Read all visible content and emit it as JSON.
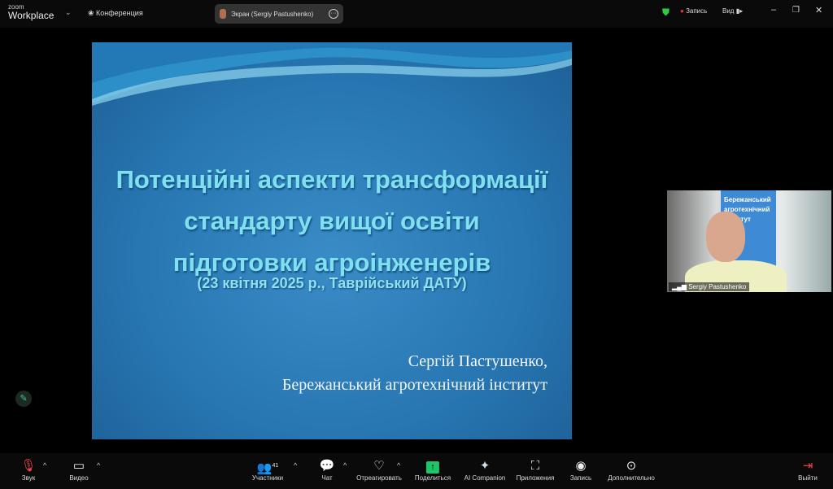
{
  "topbar": {
    "logo_small": "zoom",
    "logo_big": "Workplace",
    "meeting_label": "Конференция",
    "screen_label": "Экран (Sergiy Pastushenko)",
    "record": "Запись",
    "view": "Вид",
    "colors": {
      "shield": "#2ecc40",
      "record_dot": "#e33"
    }
  },
  "slide": {
    "title": [
      "Потенційні аспекти трансформації",
      "стандарту вищої освіти",
      "підготовки агроінженерів"
    ],
    "date": "(23 квітня 2025 р., Таврійський ДАТУ)",
    "author": [
      "Сергій Пастушенко,",
      "Бережанський агротехнічний інститут"
    ]
  },
  "video": {
    "name": "Sergiy Pastushenko",
    "banner": "Бережанський агротехнічний інститут"
  },
  "toolbar": {
    "audio": "Звук",
    "video": "Видео",
    "participants": "Участники",
    "participants_count": "41",
    "chat": "Чат",
    "react": "Отреагировать",
    "share": "Поделиться",
    "ai": "AI Companion",
    "apps": "Приложения",
    "record": "Запись",
    "more": "Дополнительно",
    "leave": "Выйти"
  }
}
